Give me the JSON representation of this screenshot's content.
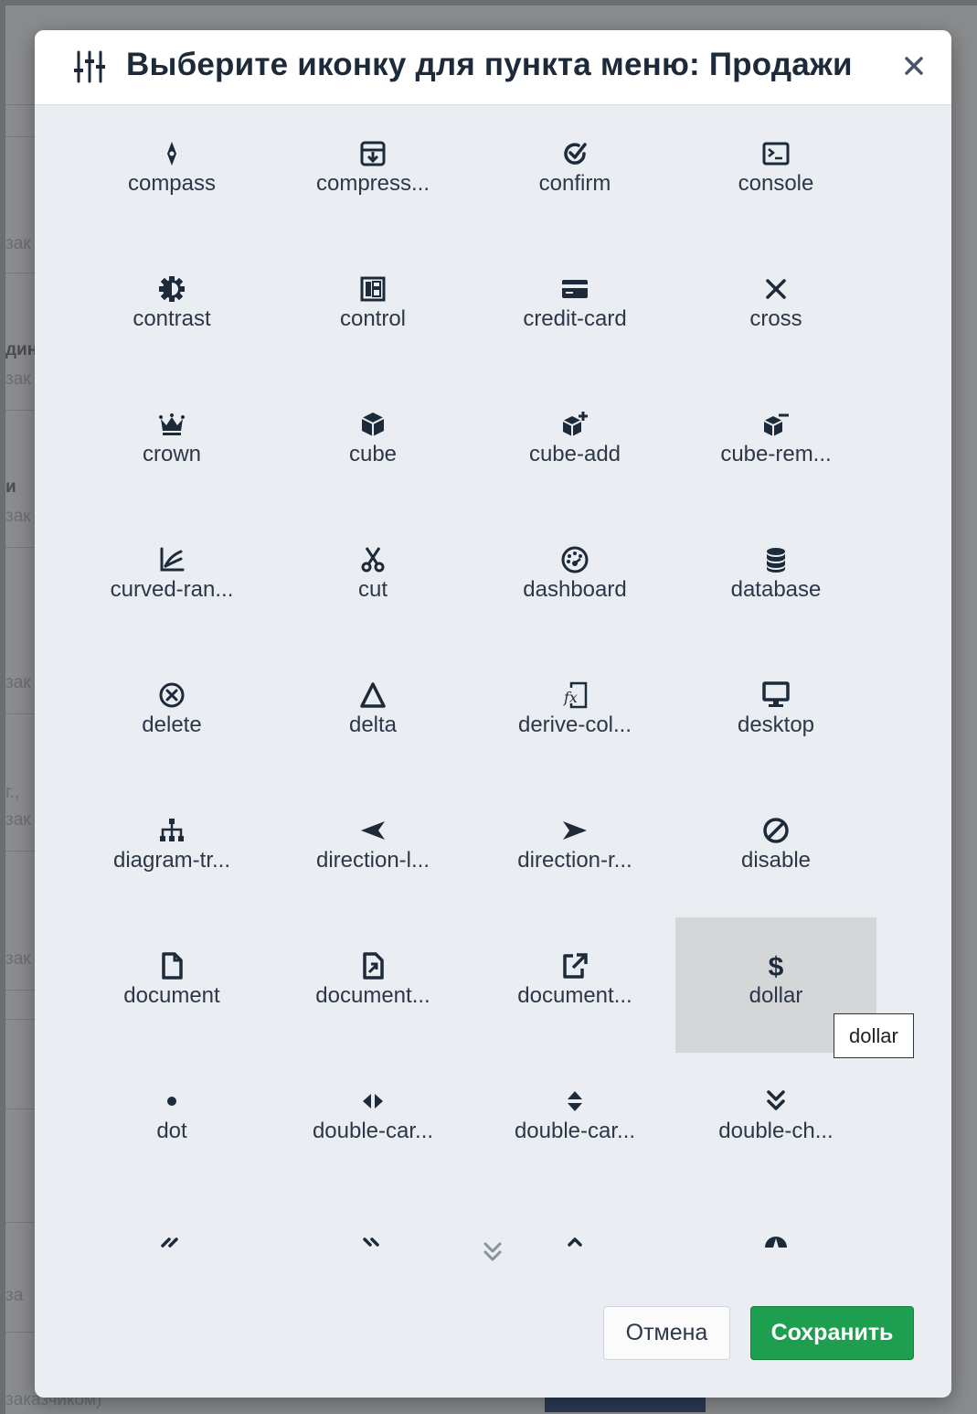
{
  "background": {
    "fragments": [
      "зак",
      "зак",
      "дин",
      "зак",
      "и",
      "зак",
      "зак",
      "г.,",
      "зак",
      "зак",
      "за"
    ],
    "bottom_text": "заказчиком)"
  },
  "dialog": {
    "title": "Выберите иконку для пункта меню: Продажи",
    "close_icon": "close-icon",
    "header_icon": "sliders-icon"
  },
  "icons": [
    {
      "label": "compass",
      "icon": "compass-icon"
    },
    {
      "label": "compress...",
      "icon": "compress-icon"
    },
    {
      "label": "confirm",
      "icon": "confirm-icon"
    },
    {
      "label": "console",
      "icon": "console-icon"
    },
    {
      "label": "contrast",
      "icon": "contrast-icon"
    },
    {
      "label": "control",
      "icon": "control-icon"
    },
    {
      "label": "credit-card",
      "icon": "credit-card-icon"
    },
    {
      "label": "cross",
      "icon": "cross-icon"
    },
    {
      "label": "crown",
      "icon": "crown-icon"
    },
    {
      "label": "cube",
      "icon": "cube-icon"
    },
    {
      "label": "cube-add",
      "icon": "cube-add-icon"
    },
    {
      "label": "cube-rem...",
      "icon": "cube-remove-icon"
    },
    {
      "label": "curved-ran...",
      "icon": "curved-range-icon"
    },
    {
      "label": "cut",
      "icon": "cut-icon"
    },
    {
      "label": "dashboard",
      "icon": "dashboard-icon"
    },
    {
      "label": "database",
      "icon": "database-icon"
    },
    {
      "label": "delete",
      "icon": "delete-icon"
    },
    {
      "label": "delta",
      "icon": "delta-icon"
    },
    {
      "label": "derive-col...",
      "icon": "derive-column-icon"
    },
    {
      "label": "desktop",
      "icon": "desktop-icon"
    },
    {
      "label": "diagram-tr...",
      "icon": "diagram-tree-icon"
    },
    {
      "label": "direction-l...",
      "icon": "direction-left-icon"
    },
    {
      "label": "direction-r...",
      "icon": "direction-right-icon"
    },
    {
      "label": "disable",
      "icon": "disable-icon"
    },
    {
      "label": "document",
      "icon": "document-icon"
    },
    {
      "label": "document...",
      "icon": "document-open-icon"
    },
    {
      "label": "document...",
      "icon": "document-share-icon"
    },
    {
      "label": "dollar",
      "icon": "dollar-icon",
      "selected": true
    },
    {
      "label": "dot",
      "icon": "dot-icon"
    },
    {
      "label": "double-car...",
      "icon": "double-caret-horizontal-icon"
    },
    {
      "label": "double-car...",
      "icon": "double-caret-vertical-icon"
    },
    {
      "label": "double-ch...",
      "icon": "double-chevron-down-icon"
    },
    {
      "label": "",
      "icon": "double-chevron-left-icon"
    },
    {
      "label": "",
      "icon": "double-chevron-right-icon"
    },
    {
      "label": "",
      "icon": "double-chevron-up-icon"
    },
    {
      "label": "",
      "icon": "drawing-icon"
    }
  ],
  "tooltip": "dollar",
  "footer": {
    "cancel_label": "Отмена",
    "save_label": "Сохранить"
  },
  "colors": {
    "dialog_bg": "#eaeef2",
    "header_bg": "#ffffff",
    "icon_color": "#1d2a3a",
    "selected_bg": "#d4d6d8",
    "save_button": "#1e9e4f"
  }
}
